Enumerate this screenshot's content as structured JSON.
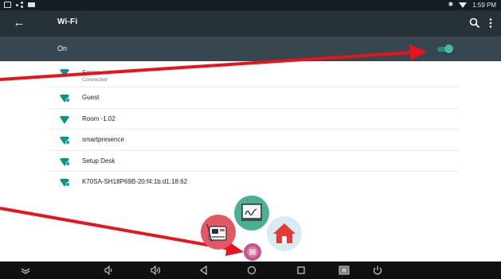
{
  "status_bar": {
    "time": "1:59 PM",
    "icons": [
      "photo-icon",
      "share-icon",
      "wallet-icon",
      "bluetooth-icon",
      "wifi-icon"
    ]
  },
  "app_bar": {
    "title": "Wi-Fi",
    "back_icon": "arrow-left-icon",
    "search_icon": "search-icon",
    "more_icon": "more-vert-icon"
  },
  "switch": {
    "label": "On",
    "checked": true,
    "accent": "#4db6ac"
  },
  "networks": [
    {
      "name": "Emice",
      "status": "Connected"
    },
    {
      "name": "Guest",
      "status": ""
    },
    {
      "name": "Room -1.02",
      "status": ""
    },
    {
      "name": "smartpresence",
      "status": ""
    },
    {
      "name": "Setup Desk",
      "status": ""
    },
    {
      "name": "K70SA-SH18P69B-20:f4:1b:d1:18:62",
      "status": ""
    }
  ],
  "floating_widget": {
    "items": [
      "whiteboard-icon",
      "screen-capture-icon",
      "home-icon",
      "menu-icon"
    ]
  },
  "nav_bar": {
    "icons": [
      "collapse-icon",
      "volume-down-icon",
      "volume-up-icon",
      "back-icon",
      "home-icon",
      "recents-icon",
      "screenshot-icon",
      "power-icon"
    ]
  },
  "colors": {
    "status_bar": "#141e22",
    "app_bar": "#263238",
    "switch_bar": "#37474f",
    "wifi_icon": "#009688",
    "annotation_arrow": "#e8141b"
  }
}
